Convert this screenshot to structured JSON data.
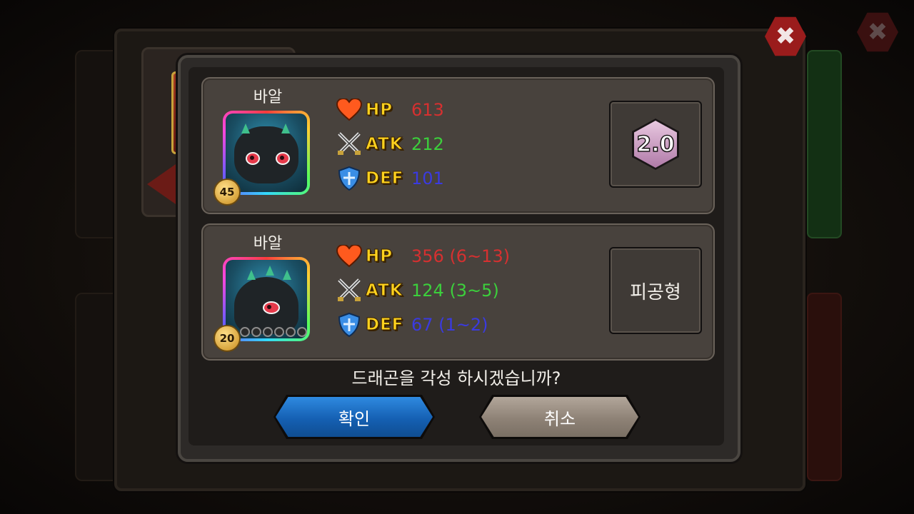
{
  "dialog": {
    "question": "드래곤을 각성 하시겠습니까?",
    "confirm_label": "확인",
    "cancel_label": "취소",
    "close_icon": "close-icon"
  },
  "cards": [
    {
      "dragon_name": "바알",
      "level": "45",
      "stats": {
        "hp_label": "HP",
        "hp_value": "613",
        "atk_label": "ATK",
        "atk_value": "212",
        "def_label": "DEF",
        "def_value": "101"
      },
      "side": {
        "badge": "2.0"
      }
    },
    {
      "dragon_name": "바알",
      "level": "20",
      "stars_empty": 6,
      "stats": {
        "hp_label": "HP",
        "hp_value": "356 (6~13)",
        "atk_label": "ATK",
        "atk_value": "124 (3~5)",
        "def_label": "DEF",
        "def_value": "67 (1~2)"
      },
      "side": {
        "type": "피공형"
      }
    }
  ],
  "colors": {
    "hp": "#d63030",
    "atk": "#3ccf3c",
    "def": "#3a3ae0",
    "stat_label": "#ffd21e",
    "confirm": "#1a6cc4",
    "cancel": "#8e8276",
    "close": "#9a1c1c"
  }
}
